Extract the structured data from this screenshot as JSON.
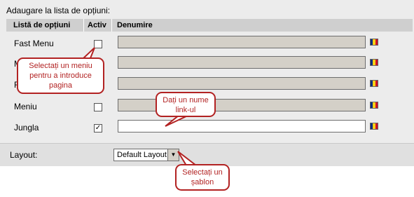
{
  "section_title": "Adaugare la lista de opțiuni:",
  "table": {
    "headers": [
      "Listă de opțiuni",
      "Activ",
      "Denumire"
    ],
    "rows": [
      {
        "label": "Fast Menu",
        "checked": false,
        "active_input": false
      },
      {
        "label": "M",
        "checked": false,
        "active_input": false
      },
      {
        "label": "F",
        "checked": false,
        "active_input": false
      },
      {
        "label": "Meniu",
        "checked": false,
        "active_input": false
      },
      {
        "label": "Jungla",
        "checked": true,
        "active_input": true
      }
    ]
  },
  "checkbox_checked_glyph": "✓",
  "flag_colors": [
    "#002b7f",
    "#fcd116",
    "#ce1126"
  ],
  "layout": {
    "label": "Layout:",
    "selected": "Default Layout",
    "dropdown_glyph": "▼"
  },
  "callouts": {
    "menu_tip": "Selectați un meniu pentru a introduce pagina",
    "name_tip": "Dați un nume link-ul",
    "template_tip": "Selectați un șablon"
  },
  "callout_color": "#b22222"
}
